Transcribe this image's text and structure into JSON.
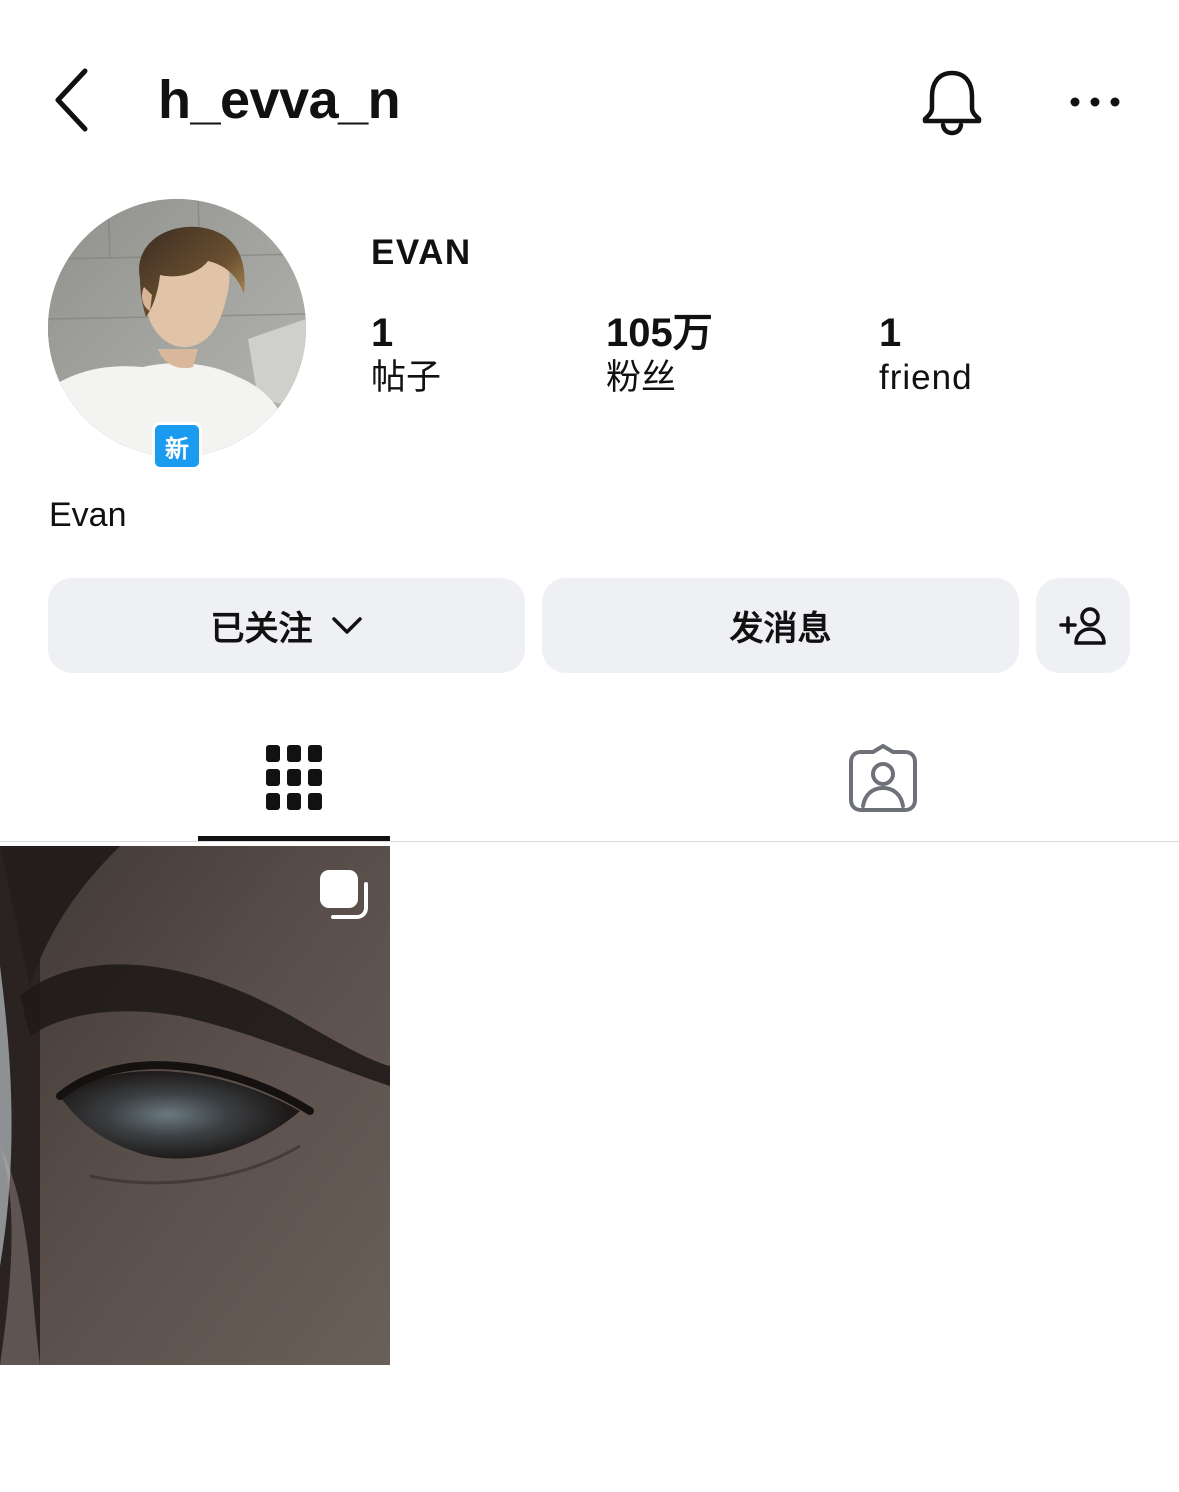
{
  "header": {
    "back_icon": "chevron-left-icon",
    "username": "h_evva_n",
    "bell_icon": "bell-icon",
    "more_icon": "more-horizontal-icon"
  },
  "profile": {
    "avatar_icon": "profile-photo",
    "new_badge": "新",
    "display_name": "EVAN",
    "bio_name": "Evan",
    "stats": [
      {
        "value": "1",
        "label": "帖子"
      },
      {
        "value": "105万",
        "label": "粉丝"
      },
      {
        "value": "1",
        "label": "friend"
      }
    ]
  },
  "actions": {
    "following_label": "已关注",
    "message_label": "发消息",
    "add_friend_icon": "add-person-icon"
  },
  "tabs": [
    {
      "name": "posts",
      "icon": "grid-icon",
      "active": true
    },
    {
      "name": "tagged",
      "icon": "tagged-person-icon",
      "active": false
    }
  ],
  "posts": [
    {
      "type": "carousel",
      "icon": "multiple-photos-icon"
    }
  ],
  "colors": {
    "badge_blue": "#1a9bf0",
    "button_bg": "#eff0f3",
    "text": "#111111",
    "inactive_icon": "#6e7278"
  }
}
